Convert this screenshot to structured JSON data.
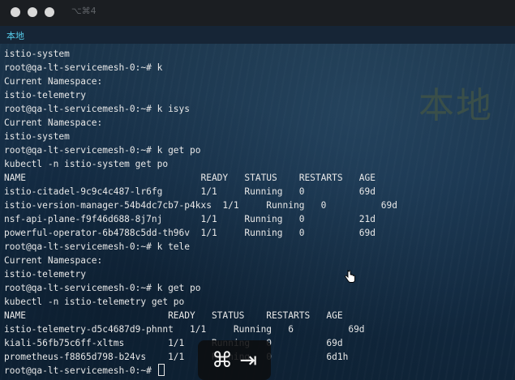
{
  "window": {
    "shortcut": "⌥⌘4",
    "tab_label": "本地",
    "watermark": "本地"
  },
  "terminal": {
    "lines": [
      "istio-system",
      "root@qa-lt-servicemesh-0:~# k",
      "Current Namespace:",
      "istio-telemetry",
      "root@qa-lt-servicemesh-0:~# k isys",
      "Current Namespace:",
      "istio-system",
      "root@qa-lt-servicemesh-0:~# k get po",
      "kubectl -n istio-system get po",
      "NAME                                READY   STATUS    RESTARTS   AGE",
      "istio-citadel-9c9c4c487-lr6fg       1/1     Running   0          69d",
      "istio-version-manager-54b4dc7cb7-p4kxs  1/1     Running   0          69d",
      "nsf-api-plane-f9f46d688-8j7nj       1/1     Running   0          21d",
      "powerful-operator-6b4788c5dd-th96v  1/1     Running   0          69d",
      "root@qa-lt-servicemesh-0:~# k tele",
      "Current Namespace:",
      "istio-telemetry",
      "root@qa-lt-servicemesh-0:~# k get po",
      "kubectl -n istio-telemetry get po",
      "NAME                          READY   STATUS    RESTARTS   AGE",
      "istio-telemetry-d5c4687d9-phnnt   1/1     Running   6          69d",
      "kiali-56fb75c6ff-xltms        1/1     Running   0          69d",
      "prometheus-f8865d798-b24vs    1/1     Running   0          6d1h"
    ],
    "prompt": "root@qa-lt-servicemesh-0:~# "
  },
  "hud": {
    "keys": "⌘ ⇥"
  }
}
